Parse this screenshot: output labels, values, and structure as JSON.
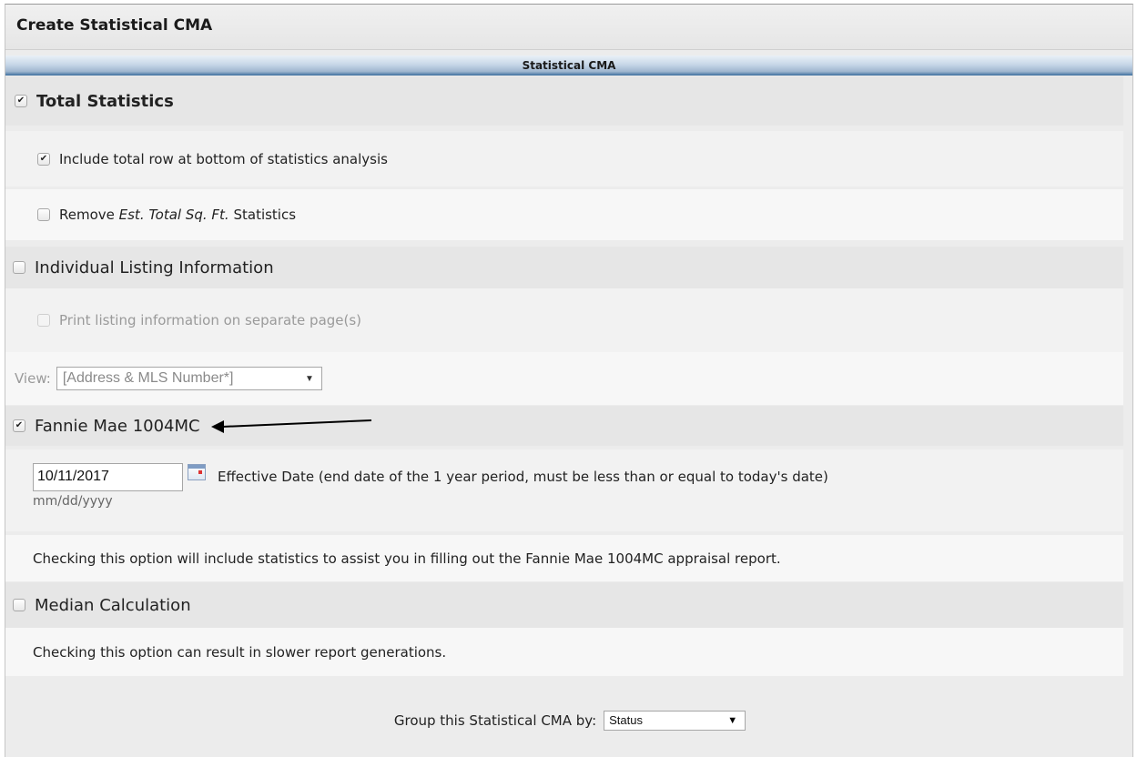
{
  "window": {
    "title": "Create Statistical CMA"
  },
  "section": {
    "header": "Statistical CMA"
  },
  "total_statistics": {
    "label": "Total Statistics",
    "checked": true,
    "include_total_row": {
      "label": "Include total row at bottom of statistics analysis",
      "checked": true
    },
    "remove_sqft": {
      "prefix": "Remove ",
      "italic": "Est. Total Sq. Ft.",
      "suffix": " Statistics",
      "checked": false
    }
  },
  "individual_listing": {
    "label": "Individual Listing Information",
    "checked": false,
    "print_separate": {
      "label": "Print listing information on separate page(s)",
      "checked": false,
      "disabled": true
    },
    "view": {
      "label": "View:",
      "value": "[Address & MLS Number*]",
      "disabled": true
    }
  },
  "fannie_mae": {
    "label": "Fannie Mae 1004MC",
    "checked": true,
    "date_value": "10/11/2017",
    "date_desc": "Effective Date (end date of the 1 year period, must be less than or equal to today's date)",
    "date_format": "mm/dd/yyyy",
    "note": "Checking this option will include statistics to assist you in filling out the Fannie Mae 1004MC appraisal report."
  },
  "median": {
    "label": "Median Calculation",
    "checked": false,
    "note": "Checking this option can result in slower report generations."
  },
  "group_by": {
    "label": "Group this Statistical CMA by:",
    "value": "Status"
  },
  "icons": {
    "calendar": "calendar-icon",
    "arrow": "annotation-arrow-icon",
    "dropdown": "chevron-down-icon"
  }
}
